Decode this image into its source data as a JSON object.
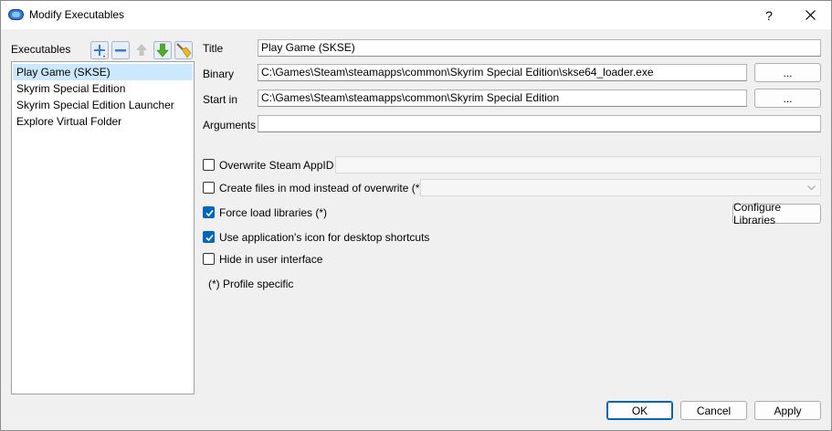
{
  "window": {
    "title": "Modify Executables",
    "help_glyph": "?",
    "close_glyph": "✕"
  },
  "executables": {
    "label": "Executables",
    "items": [
      {
        "label": "Play Game (SKSE)",
        "selected": true
      },
      {
        "label": "Skyrim Special Edition",
        "selected": false
      },
      {
        "label": "Skyrim Special Edition Launcher",
        "selected": false
      },
      {
        "label": "Explore Virtual Folder",
        "selected": false
      }
    ]
  },
  "form": {
    "title_label": "Title",
    "title_value": "Play Game (SKSE)",
    "binary_label": "Binary",
    "binary_value": "C:\\Games\\Steam\\steamapps\\common\\Skyrim Special Edition\\skse64_loader.exe",
    "binary_browse": "...",
    "startin_label": "Start in",
    "startin_value": "C:\\Games\\Steam\\steamapps\\common\\Skyrim Special Edition",
    "startin_browse": "...",
    "arguments_label": "Arguments",
    "arguments_value": ""
  },
  "options": {
    "overwrite_appid": {
      "label": "Overwrite Steam AppID",
      "checked": false
    },
    "create_files": {
      "label": "Create files in mod instead of overwrite (*)",
      "checked": false
    },
    "force_load": {
      "label": "Force load libraries (*)",
      "checked": true
    },
    "use_icon": {
      "label": "Use application's icon for desktop shortcuts",
      "checked": true
    },
    "hide_ui": {
      "label": "Hide in user interface",
      "checked": false
    },
    "configure_libraries": "Configure Libraries",
    "profile_note": "(*) Profile specific"
  },
  "footer": {
    "ok": "OK",
    "cancel": "Cancel",
    "apply": "Apply"
  },
  "colors": {
    "accent": "#0067c0",
    "selection": "#cce8ff",
    "add_icon": "#3a7bd5",
    "move_down_icon": "#4caf24",
    "clean_icon": "#e8b923"
  }
}
